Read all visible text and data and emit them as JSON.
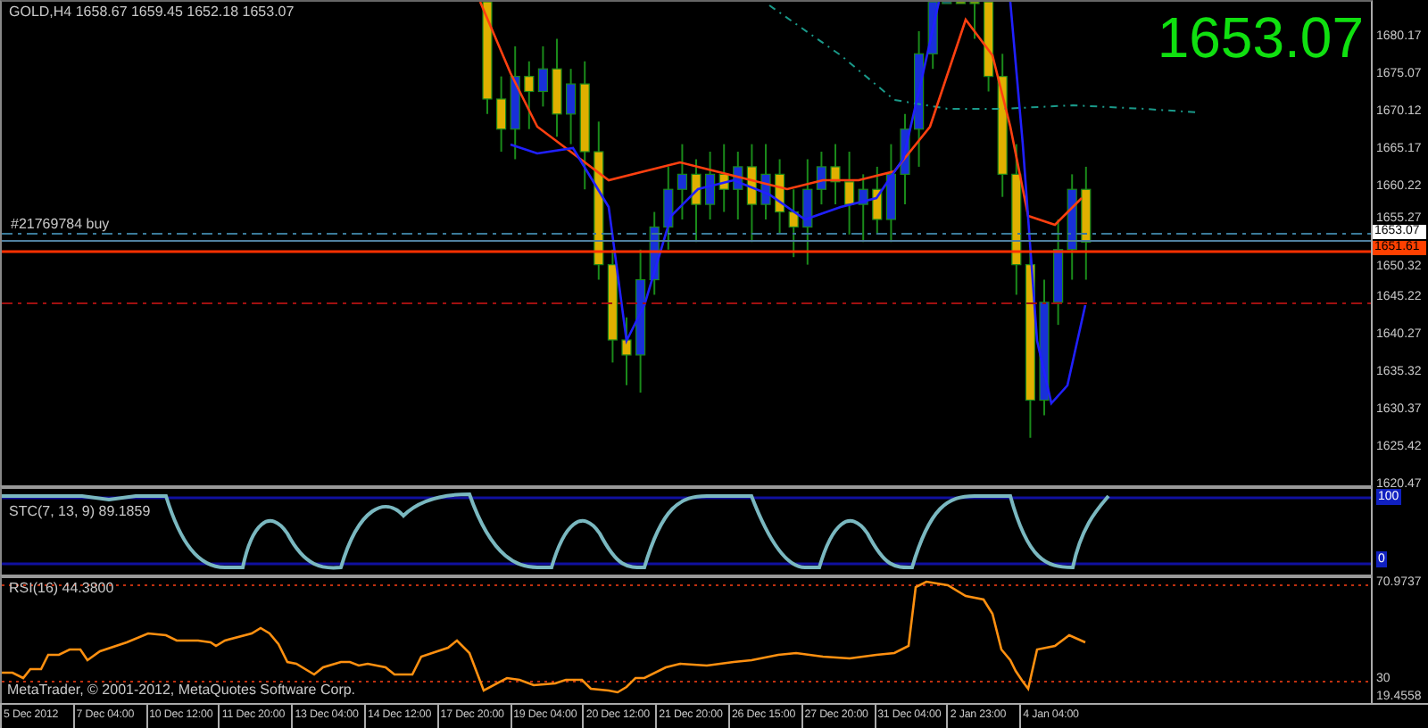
{
  "price_pane": {
    "symbol_info": "GOLD,H4  1658.67 1659.45 1652.18 1653.07",
    "big_price": "1653.07",
    "order_label": "#21769784 buy",
    "ticks": [
      "1680.17",
      "1675.07",
      "1670.12",
      "1665.17",
      "1660.22",
      "1655.27",
      "1650.32",
      "1645.22",
      "1640.27",
      "1635.32",
      "1630.37",
      "1625.42",
      "1620.47"
    ],
    "bid_label": "1653.07",
    "order_price_label": "1651.61"
  },
  "stc_pane": {
    "label": "STC(7, 13, 9) 89.1859",
    "ticks": [
      "100",
      "0"
    ]
  },
  "rsi_pane": {
    "label": "RSI(16) 44.3800",
    "ticks": [
      "70.9737",
      "30",
      "19.4558"
    ]
  },
  "copyright": "MetaTrader, © 2001-2012, MetaQuotes Software Corp.",
  "time_axis": [
    "5 Dec 2012",
    "7 Dec 04:00",
    "10 Dec 12:00",
    "11 Dec 20:00",
    "13 Dec 04:00",
    "14 Dec 12:00",
    "17 Dec 20:00",
    "19 Dec 04:00",
    "20 Dec 12:00",
    "21 Dec 20:00",
    "26 Dec 15:00",
    "27 Dec 20:00",
    "31 Dec 04:00",
    "2 Jan 23:00",
    "4 Jan 04:00"
  ]
}
